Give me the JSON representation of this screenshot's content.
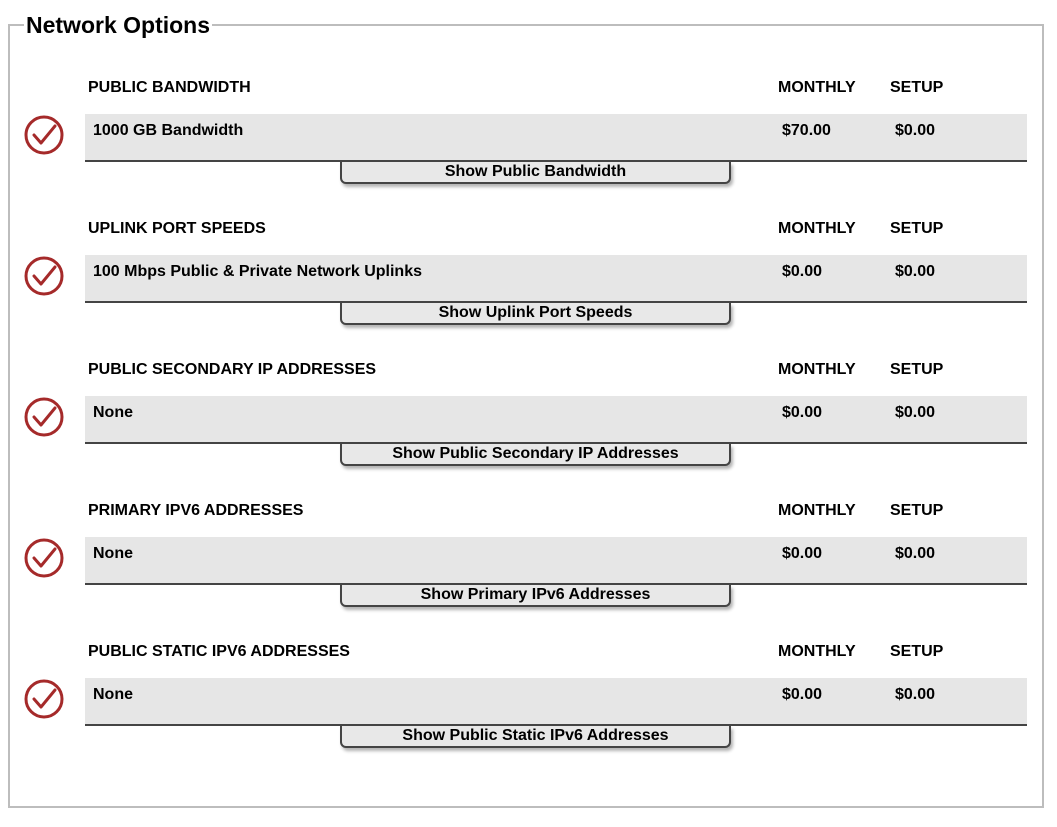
{
  "title": "Network Options",
  "columns": {
    "monthly": "MONTHLY",
    "setup": "SETUP"
  },
  "icons": {
    "selected": "check-circle-icon",
    "accent": "#a52a2a"
  },
  "sections": [
    {
      "heading": "PUBLIC BANDWIDTH",
      "selection": "1000 GB Bandwidth",
      "monthly": "$70.00",
      "setup": "$0.00",
      "button": "Show Public Bandwidth"
    },
    {
      "heading": "UPLINK PORT SPEEDS",
      "selection": "100 Mbps Public & Private Network Uplinks",
      "monthly": "$0.00",
      "setup": "$0.00",
      "button": "Show Uplink Port Speeds"
    },
    {
      "heading": "PUBLIC SECONDARY IP ADDRESSES",
      "selection": "None",
      "monthly": "$0.00",
      "setup": "$0.00",
      "button": "Show Public Secondary IP Addresses"
    },
    {
      "heading": "PRIMARY IPV6 ADDRESSES",
      "selection": "None",
      "monthly": "$0.00",
      "setup": "$0.00",
      "button": "Show Primary IPv6 Addresses"
    },
    {
      "heading": "PUBLIC STATIC IPV6 ADDRESSES",
      "selection": "None",
      "monthly": "$0.00",
      "setup": "$0.00",
      "button": "Show Public Static IPv6 Addresses"
    }
  ]
}
